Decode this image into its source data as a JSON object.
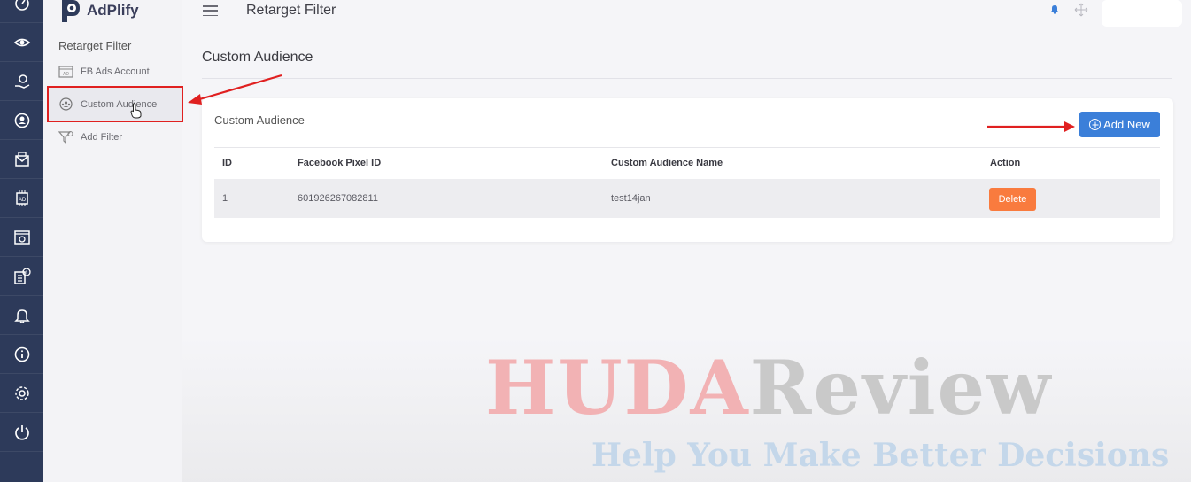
{
  "app": {
    "name": "AdPlify"
  },
  "header": {
    "title": "Retarget Filter"
  },
  "sidebar": {
    "heading": "Retarget Filter",
    "items": [
      {
        "label": "FB Ads Account",
        "icon": "ads-account-icon"
      },
      {
        "label": "Custom Audience",
        "icon": "audience-icon"
      },
      {
        "label": "Add Filter",
        "icon": "filter-icon"
      }
    ]
  },
  "rail": {
    "icons": [
      "dashboard-icon",
      "eye-icon",
      "hand-dollar-icon",
      "user-pin-icon",
      "mail-icon",
      "ad-chip-icon",
      "browser-target-icon",
      "facebook-grid-icon",
      "bell-icon",
      "info-icon",
      "settings-icon",
      "power-icon"
    ]
  },
  "main": {
    "page_title": "Custom Audience",
    "card_title": "Custom Audience",
    "add_button": "Add New",
    "table": {
      "headers": [
        "ID",
        "Facebook Pixel ID",
        "Custom Audience Name",
        "Action"
      ],
      "rows": [
        {
          "id": "1",
          "pixel_id": "601926267082811",
          "name": "test14jan",
          "action": "Delete"
        }
      ]
    }
  },
  "watermark": {
    "brand_a": "HUDA",
    "brand_b": "Review",
    "tagline": "Help You Make Better Decisions"
  },
  "colors": {
    "rail": "#2d3a5a",
    "primary": "#3b7fd9",
    "danger": "#f97b3e",
    "annotation": "#e02020"
  }
}
